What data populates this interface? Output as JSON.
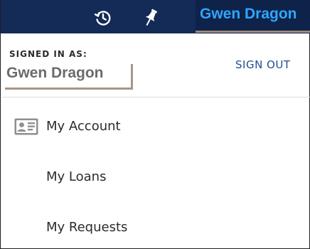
{
  "topbar": {
    "history_icon": "history-icon",
    "pin_icon": "pushpin-icon",
    "user_name": "Gwen Dragon"
  },
  "account": {
    "signed_in_label": "SIGNED IN AS:",
    "user_name": "Gwen Dragon",
    "sign_out_label": "SIGN OUT"
  },
  "menu": {
    "items": [
      {
        "label": "My Account",
        "icon": "id-card-icon"
      },
      {
        "label": "My Loans"
      },
      {
        "label": "My Requests"
      }
    ]
  },
  "colors": {
    "topbar_bg": "#142a57",
    "username_accent": "#2ea6ff",
    "link": "#1f4f8e",
    "highlight_border": "#a89684"
  }
}
